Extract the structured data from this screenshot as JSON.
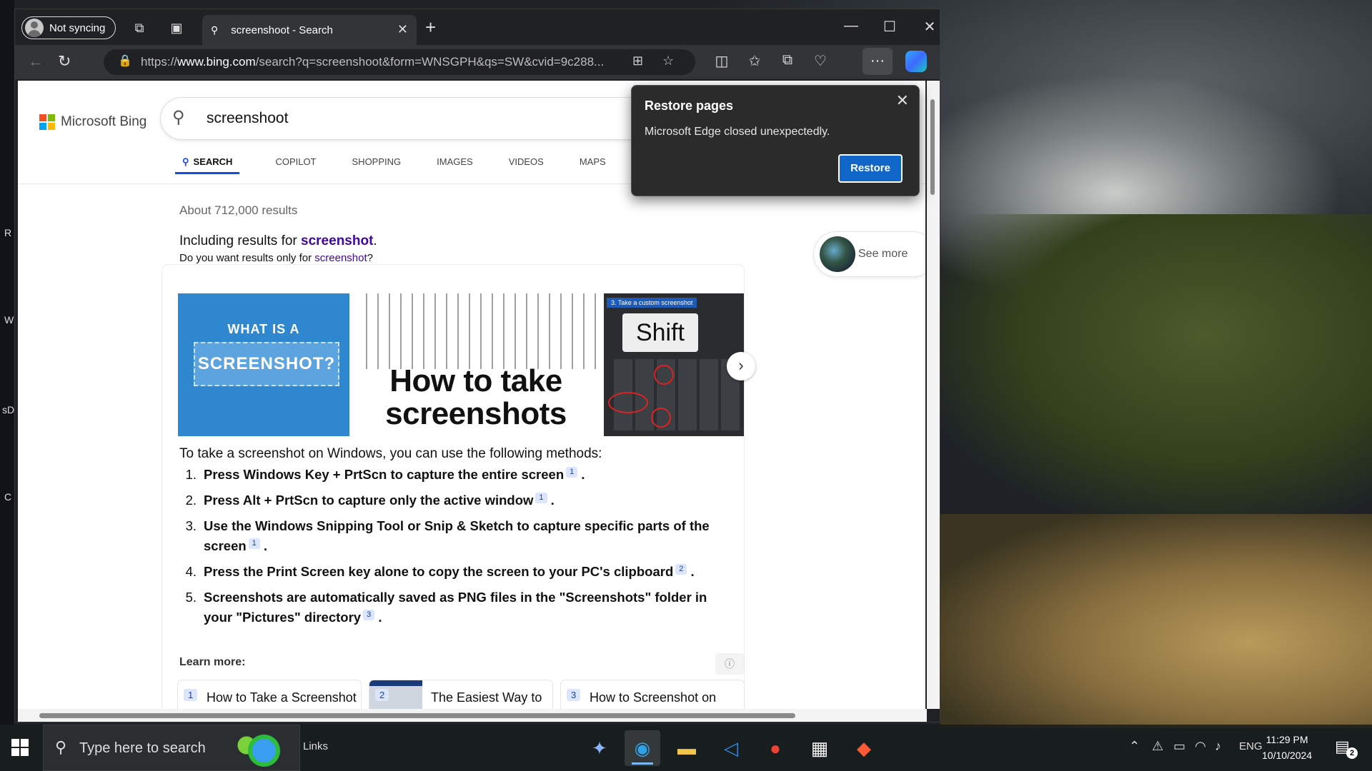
{
  "browser": {
    "profile_label": "Not syncing",
    "tab_title": "screenshoot - Search",
    "url_prefix": "https://",
    "url_domain": "www.bing.com",
    "url_path": "/search?q=screenshoot&form=WNSGPH&qs=SW&cvid=9c288..."
  },
  "bing": {
    "logo_text": "Microsoft Bing",
    "query": "screenshoot",
    "tabs": [
      "SEARCH",
      "COPILOT",
      "SHOPPING",
      "IMAGES",
      "VIDEOS",
      "MAPS"
    ],
    "result_count": "About 712,000 results",
    "including_prefix": "Including results for ",
    "including_term": "screenshot",
    "including_suffix": ".",
    "doyou_prefix": "Do you want results only for ",
    "doyou_term": "screenshot",
    "doyou_suffix": "?",
    "see_more": "See more",
    "images": {
      "img1_line1": "WHAT IS A",
      "img1_line2": "SCREENSHOT?",
      "img2_line1": "How to take",
      "img2_line2": "screenshots",
      "img3_label": "3. Take a custom screenshot",
      "img3_key": "Shift"
    },
    "answer": {
      "intro": "To take a screenshot on Windows, you can use the following methods:",
      "methods": [
        {
          "num": "1.",
          "text": "Press Windows Key + PrtScn to capture the entire screen",
          "cite": "1"
        },
        {
          "num": "2.",
          "text": "Press Alt + PrtScn to capture only the active window",
          "cite": "1"
        },
        {
          "num": "3.",
          "text": "Use the Windows Snipping Tool or Snip & Sketch to capture specific parts of the screen",
          "cite": "1"
        },
        {
          "num": "4.",
          "text": "Press the Print Screen key alone to copy the screen to your PC's clipboard",
          "cite": "2"
        },
        {
          "num": "5.",
          "text": "Screenshots are automatically saved as PNG files in the \"Screenshots\" folder in your \"Pictures\" directory",
          "cite": "3"
        }
      ],
      "learn_more": "Learn more:",
      "sources": [
        {
          "num": "1",
          "title": "How to Take a Screenshot"
        },
        {
          "num": "2",
          "title": "The Easiest Way to"
        },
        {
          "num": "3",
          "title": "How to Screenshot on"
        }
      ]
    }
  },
  "restore_popup": {
    "title": "Restore pages",
    "message": "Microsoft Edge closed unexpectedly.",
    "button": "Restore"
  },
  "taskbar": {
    "search_placeholder": "Type here to search",
    "links_label": "Links",
    "language": "ENG",
    "time": "11:29 PM",
    "date": "10/10/2024",
    "notification_count": "2"
  },
  "desktop": {
    "edge_letters": [
      "R",
      "W",
      "sD",
      "C"
    ]
  },
  "colors": {
    "accent": "#174ae4",
    "restore_button": "#1166c9",
    "visited_link": "#4007a2"
  }
}
